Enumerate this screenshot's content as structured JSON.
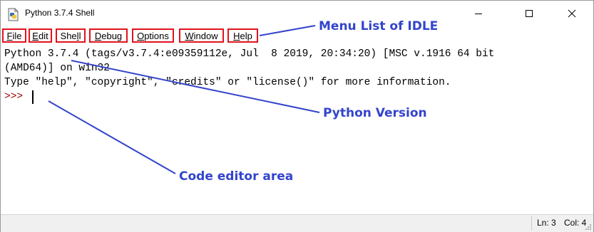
{
  "window": {
    "title": "Python 3.7.4 Shell"
  },
  "menu": [
    {
      "pre": "",
      "u": "F",
      "post": "ile"
    },
    {
      "pre": "",
      "u": "E",
      "post": "dit"
    },
    {
      "pre": "She",
      "u": "l",
      "post": "l"
    },
    {
      "pre": "",
      "u": "D",
      "post": "ebug"
    },
    {
      "pre": "",
      "u": "O",
      "post": "ptions"
    },
    {
      "pre": "",
      "u": "W",
      "post": "indow"
    },
    {
      "pre": "",
      "u": "H",
      "post": "elp"
    }
  ],
  "editor": {
    "line1": "Python 3.7.4 (tags/v3.7.4:e09359112e, Jul  8 2019, 20:34:20) [MSC v.1916 64 bit",
    "line2": "(AMD64)] on win32",
    "line3": "Type \"help\", \"copyright\", \"credits\" or \"license()\" for more information.",
    "prompt": ">>> "
  },
  "status": {
    "line": "Ln: 3",
    "col": "Col: 4"
  },
  "annotations": {
    "menu": "Menu List of IDLE",
    "version": "Python Version",
    "editor": "Code editor area"
  },
  "colors": {
    "annotation": "#3344cc",
    "highlight_box": "#e0141c",
    "prompt": "#a00000"
  },
  "icons": {
    "app": "python-idle-icon",
    "minimize": "minimize-icon",
    "maximize": "maximize-icon",
    "close": "close-icon"
  }
}
